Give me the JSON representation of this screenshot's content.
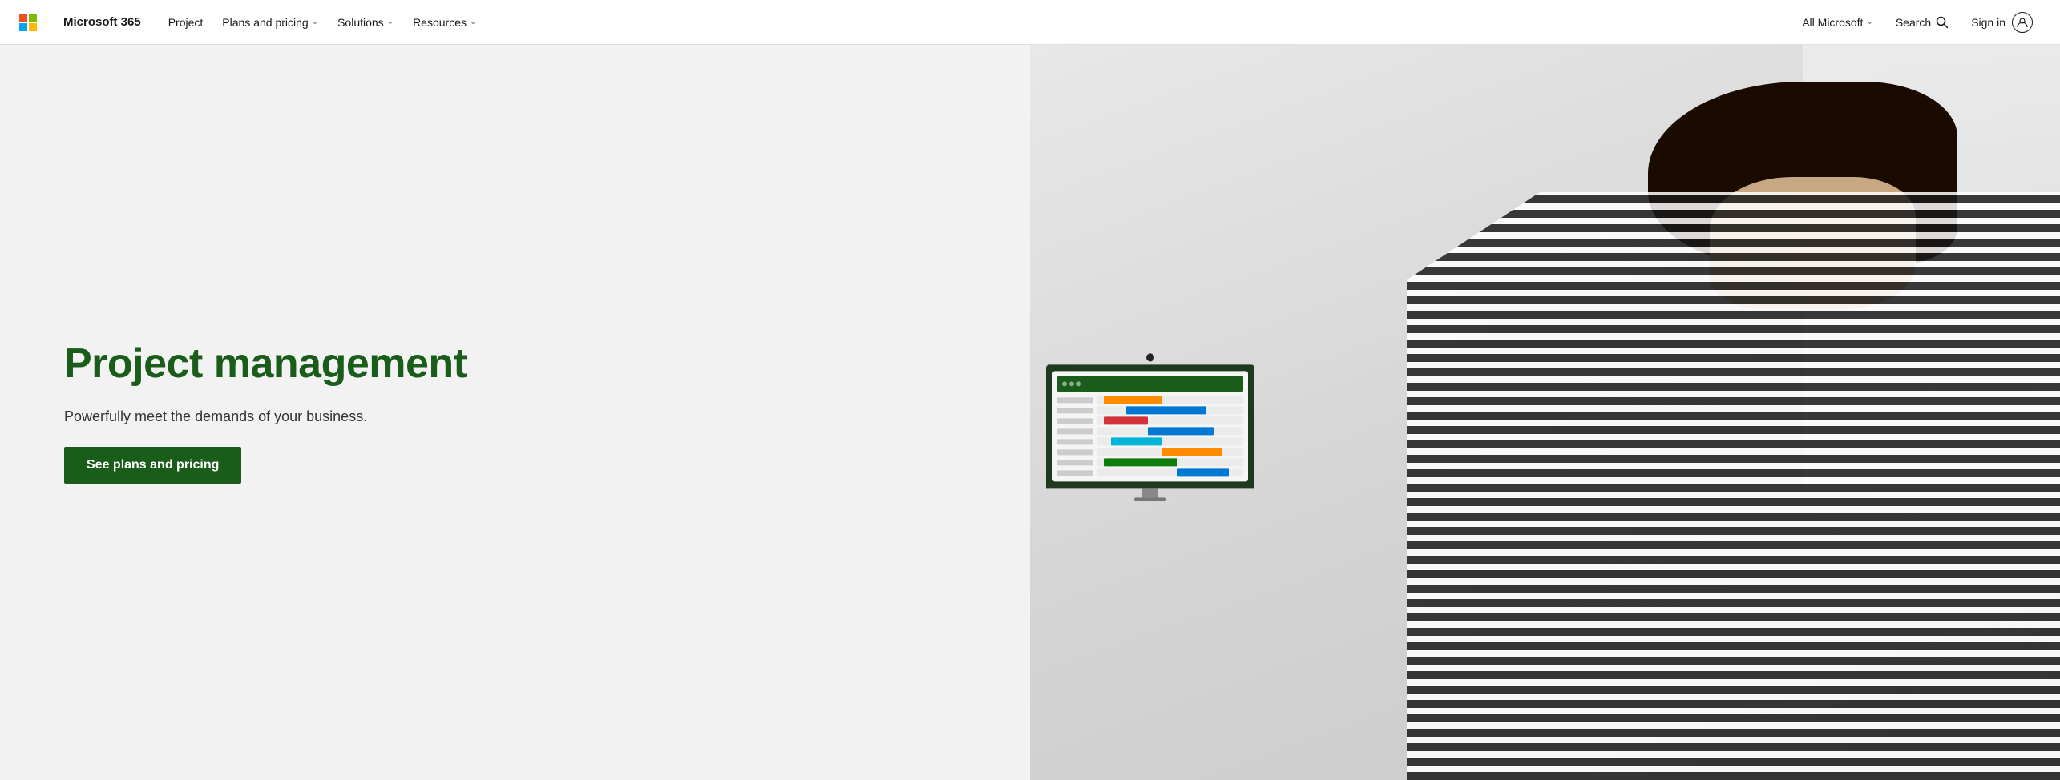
{
  "brand": {
    "ms_name": "Microsoft",
    "product_name": "Microsoft 365"
  },
  "nav": {
    "product_link": "Project",
    "plans_label": "Plans and pricing",
    "solutions_label": "Solutions",
    "resources_label": "Resources",
    "all_microsoft_label": "All Microsoft",
    "search_label": "Search",
    "signin_label": "Sign in"
  },
  "hero": {
    "heading": "Project management",
    "subheading": "Powerfully meet the demands of your business.",
    "cta_label": "See plans and pricing"
  },
  "gantt": {
    "rows": [
      {
        "color": "bar-orange",
        "left": "5%",
        "width": "40%"
      },
      {
        "color": "bar-blue",
        "left": "20%",
        "width": "55%"
      },
      {
        "color": "bar-red",
        "left": "5%",
        "width": "30%"
      },
      {
        "color": "bar-blue",
        "left": "35%",
        "width": "45%"
      },
      {
        "color": "bar-teal",
        "left": "10%",
        "width": "35%"
      },
      {
        "color": "bar-orange",
        "left": "45%",
        "width": "40%"
      },
      {
        "color": "bar-green",
        "left": "5%",
        "width": "50%"
      },
      {
        "color": "bar-blue",
        "left": "55%",
        "width": "35%"
      }
    ]
  }
}
